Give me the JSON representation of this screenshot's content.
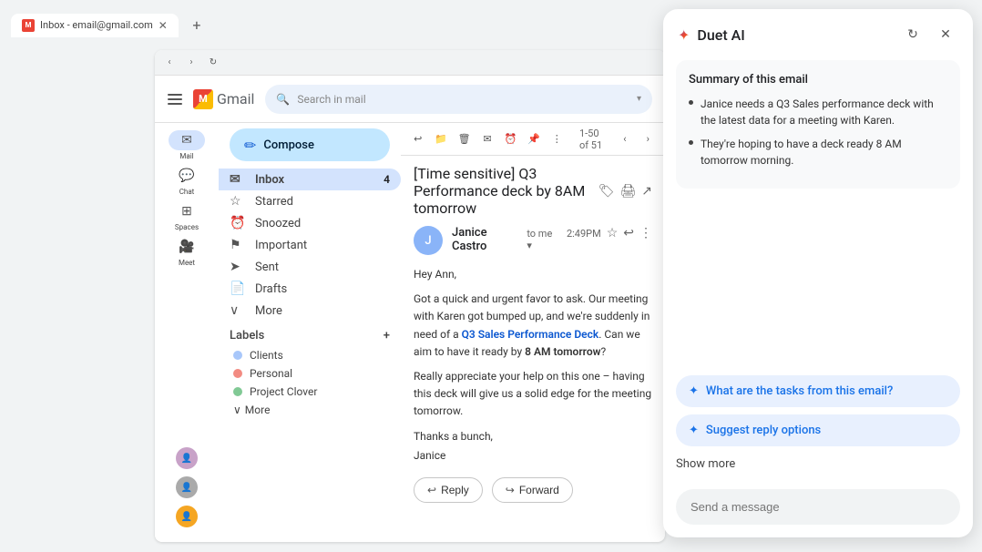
{
  "browser": {
    "tab_label": "Inbox - email@gmail.com",
    "tab_favicon": "M",
    "new_tab_label": "+"
  },
  "gmail": {
    "logo_text": "Gmail",
    "search_placeholder": "Search in mail",
    "compose_label": "Compose",
    "nav_items": [
      {
        "label": "Inbox",
        "icon": "✉",
        "badge": "4",
        "active": true
      },
      {
        "label": "Starred",
        "icon": "☆",
        "badge": "",
        "active": false
      },
      {
        "label": "Snoozed",
        "icon": "⏰",
        "badge": "",
        "active": false
      },
      {
        "label": "Important",
        "icon": "⚑",
        "badge": "",
        "active": false
      },
      {
        "label": "Sent",
        "icon": "➤",
        "badge": "",
        "active": false
      },
      {
        "label": "Drafts",
        "icon": "📄",
        "badge": "",
        "active": false
      },
      {
        "label": "More",
        "icon": "∨",
        "badge": "",
        "active": false
      }
    ],
    "labels_header": "Labels",
    "labels": [
      {
        "name": "Clients",
        "color": "#a8c7fa"
      },
      {
        "name": "Personal",
        "color": "#f28b82"
      },
      {
        "name": "Project Clover",
        "color": "#81c995"
      }
    ],
    "labels_more": "More",
    "sidebar_items": [
      {
        "label": "Mail",
        "icon": "✉"
      },
      {
        "label": "Chat",
        "icon": "💬"
      },
      {
        "label": "Spaces",
        "icon": "⊞"
      },
      {
        "label": "Meet",
        "icon": "📹"
      }
    ],
    "toolbar_icons": [
      "↩",
      "📁",
      "🗑",
      "✉",
      "⏰",
      "📌",
      "⋮"
    ],
    "pagination": "1-50 of 51",
    "email": {
      "subject": "[Time sensitive] Q3 Performance deck by 8AM tomorrow",
      "sender_name": "Janice Castro",
      "sender_to": "to me ▾",
      "time": "2:49PM",
      "avatar_letter": "J",
      "body_greeting": "Hey Ann,",
      "body_para1": "Got a quick and urgent favor to ask. Our meeting with Karen got bumped up, and we're suddenly in need of a Q3 Sales Performance Deck. Can we aim to have it ready by 8 AM tomorrow?",
      "highlighted_phrase": "Q3 Sales Performance Deck",
      "bold_time": "8 AM tomorrow",
      "body_para2": "Really appreciate your help on this one – having this deck will give us a solid edge for the meeting tomorrow.",
      "body_closing": "Thanks a bunch,",
      "body_signature": "Janice",
      "reply_label": "Reply",
      "forward_label": "Forward"
    }
  },
  "duet": {
    "title": "Duet AI",
    "star_icon": "✦",
    "refresh_icon": "↻",
    "close_icon": "✕",
    "summary_title": "Summary of this email",
    "bullets": [
      "Janice needs a Q3 Sales performance deck with the latest data for a meeting with Karen.",
      "They're hoping to have a deck ready 8 AM tomorrow morning."
    ],
    "suggestions": [
      {
        "label": "What are the tasks from this email?",
        "icon": "✦"
      },
      {
        "label": "Suggest reply options",
        "icon": "✦"
      }
    ],
    "show_more": "Show more",
    "input_placeholder": "Send a message"
  }
}
